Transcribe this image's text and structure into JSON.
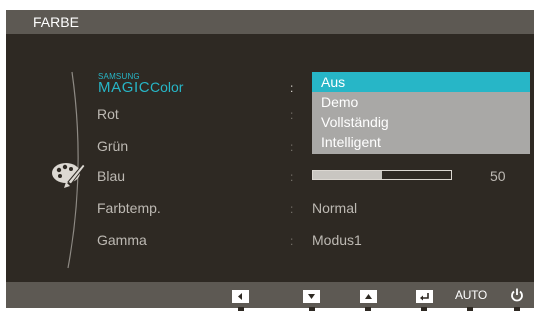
{
  "window": {
    "title": "FARBE"
  },
  "menu": {
    "category_icon": "palette-icon",
    "items": [
      {
        "samsung": "SAMSUNG",
        "magic": "MAGIC",
        "label": "Color"
      },
      {
        "label": "Rot"
      },
      {
        "label": "Grün"
      },
      {
        "label": "Blau"
      },
      {
        "label": "Farbtemp."
      },
      {
        "label": "Gamma"
      }
    ],
    "separator": ":"
  },
  "dropdown": {
    "options": [
      "Aus",
      "Demo",
      "Vollständig",
      "Intelligent"
    ],
    "selected": "Aus"
  },
  "blau_slider": {
    "value": 50,
    "value_text": "50",
    "fill_fraction": 0.5
  },
  "farbtemp": {
    "value": "Normal"
  },
  "gamma": {
    "value": "Modus1"
  },
  "bottom_bar": {
    "buttons": [
      "left-arrow-icon",
      "down-arrow-icon",
      "up-arrow-icon",
      "enter-icon"
    ],
    "auto_label": "AUTO",
    "power_icon": "power-icon"
  },
  "colors": {
    "accent": "#27b6c7",
    "panel_bg": "#2e2923",
    "bar_bg": "#5d5953",
    "dropdown_bg": "#a9a8a6"
  }
}
